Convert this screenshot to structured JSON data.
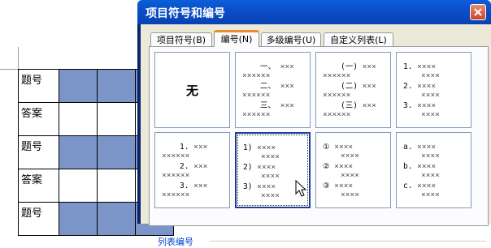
{
  "document": {
    "rows": [
      {
        "label": "题号"
      },
      {
        "label": "答案"
      },
      {
        "label": "题号"
      },
      {
        "label": "答案"
      },
      {
        "label": "题号"
      }
    ]
  },
  "dialog": {
    "title": "项目符号和编号",
    "tabs": [
      {
        "label": "项目符号(B)"
      },
      {
        "label": "编号(N)"
      },
      {
        "label": "多级编号(U)"
      },
      {
        "label": "自定义列表(L)"
      }
    ],
    "options": [
      {
        "name": "none",
        "label": "无"
      },
      {
        "name": "chinese-comma",
        "marks": [
          "一、",
          "二、",
          "三、"
        ]
      },
      {
        "name": "chinese-paren",
        "marks": [
          "(一)",
          "(二)",
          "(三)"
        ]
      },
      {
        "name": "arabic-dot",
        "marks": [
          "1.",
          "2.",
          "3."
        ]
      },
      {
        "name": "arabic-dot-right",
        "marks": [
          "1.",
          "2.",
          "3."
        ]
      },
      {
        "name": "arabic-paren",
        "marks": [
          "1)",
          "2)",
          "3)"
        ]
      },
      {
        "name": "circled",
        "marks": [
          "①",
          "②",
          "③"
        ]
      },
      {
        "name": "alpha-dot",
        "marks": [
          "a.",
          "b.",
          "c."
        ]
      }
    ],
    "filler": "××××",
    "selected_option": "arabic-paren",
    "group_label": "列表编号",
    "colors": {
      "accent": "#e68b2c",
      "titlebar": "#0a4fc9",
      "link": "#0046d5"
    }
  }
}
